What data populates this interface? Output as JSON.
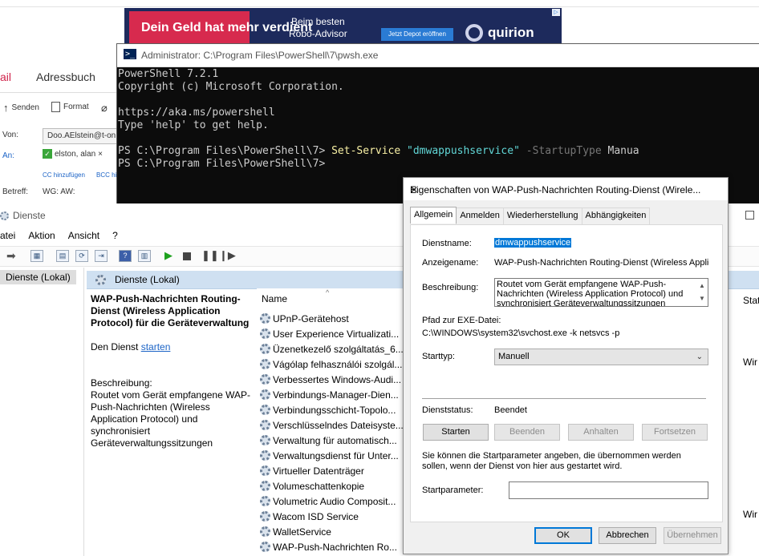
{
  "mail": {
    "tab_mail": "ail",
    "tab_address": "Adressbuch",
    "toolbar": {
      "send": "Senden",
      "format": "Format"
    },
    "from_label": "Von:",
    "from_value": "Doo.AElstein@t-on",
    "to_label": "An:",
    "to_value": "elston, alan",
    "to_remove": "×",
    "cc_link": "CC hinzufügen",
    "bcc_link": "BCC hi",
    "subject_label": "Betreff:",
    "subject_value": "WG: AW:"
  },
  "ad": {
    "headline": "Dein Geld hat mehr verdient",
    "sub_line1": "Beim besten",
    "sub_line2": "Robo-Advisor",
    "button": "Jetzt Depot eröffnen",
    "brand": "quirion",
    "corner": "▷"
  },
  "powershell": {
    "title": "Administrator: C:\\Program Files\\PowerShell\\7\\pwsh.exe",
    "lines": {
      "l1": "PowerShell 7.2.1",
      "l2": "Copyright (c) Microsoft Corporation.",
      "l3": "https://aka.ms/powershell",
      "l4": "Type 'help' to get help.",
      "prompt": "PS C:\\Program Files\\PowerShell\\7> ",
      "cmd": "Set-Service",
      "arg": "\"dmwappushservice\"",
      "param": "-StartupType",
      "paramval": "Manua",
      "prompt2": "PS C:\\Program Files\\PowerShell\\7>"
    }
  },
  "services": {
    "title": "Dienste",
    "menu": [
      "atei",
      "Aktion",
      "Ansicht",
      "?"
    ],
    "tree_item": "Dienste (Lokal)",
    "pane_title": "Dienste (Lokal)",
    "detail": {
      "heading": "WAP-Push-Nachrichten Routing-Dienst (Wireless Application Protocol) für die Geräteverwaltung",
      "start_prefix": "Den Dienst ",
      "start_link": "starten",
      "desc_label": "Beschreibung:",
      "desc_text": "Routet vom Gerät empfangene WAP-Push-Nachrichten (Wireless Application Protocol) und synchronisiert Geräteverwaltungssitzungen"
    },
    "column_name": "Name",
    "column_status": "Stat",
    "rows": [
      "UPnP-Gerätehost",
      "User Experience Virtualizati...",
      "Üzenetkezelő szolgáltatás_6...",
      "Vágólap felhasználói szolgál...",
      "Verbessertes Windows-Audi...",
      "Verbindungs-Manager-Dien...",
      "Verbindungsschicht-Topolo...",
      "Verschlüsselndes Dateisyste...",
      "Verwaltung für automatisch...",
      "Verwaltungsdienst für Unter...",
      "Virtueller Datenträger",
      "Volumeschattenkopie",
      "Volumetric Audio Composit...",
      "Wacom ISD Service",
      "WalletService",
      "WAP-Push-Nachrichten Ro..."
    ],
    "right_col": [
      "Wir",
      "Wir"
    ],
    "dots": "..."
  },
  "dialog": {
    "title": "Eigenschaften von WAP-Push-Nachrichten Routing-Dienst (Wirele...",
    "close": "✕",
    "tabs": [
      "Allgemein",
      "Anmelden",
      "Wiederherstellung",
      "Abhängigkeiten"
    ],
    "service_name_label": "Dienstname:",
    "service_name": "dmwappushservice",
    "display_name_label": "Anzeigename:",
    "display_name": "WAP-Push-Nachrichten Routing-Dienst (Wireless Applica",
    "description_label": "Beschreibung:",
    "description": "Routet vom Gerät empfangene WAP-Push-Nachrichten (Wireless Application Protocol) und synchronisiert Geräteverwaltungssitzungen",
    "path_label": "Pfad zur EXE-Datei:",
    "path": "C:\\WINDOWS\\system32\\svchost.exe -k netsvcs -p",
    "startup_label": "Starttyp:",
    "startup_value": "Manuell",
    "status_label": "Dienststatus:",
    "status_value": "Beendet",
    "btn_start": "Starten",
    "btn_stop": "Beenden",
    "btn_pause": "Anhalten",
    "btn_resume": "Fortsetzen",
    "hint": "Sie können die Startparameter angeben, die übernommen werden sollen, wenn der Dienst von hier aus gestartet wird.",
    "param_label": "Startparameter:",
    "ok": "OK",
    "cancel": "Abbrechen",
    "apply": "Übernehmen"
  }
}
